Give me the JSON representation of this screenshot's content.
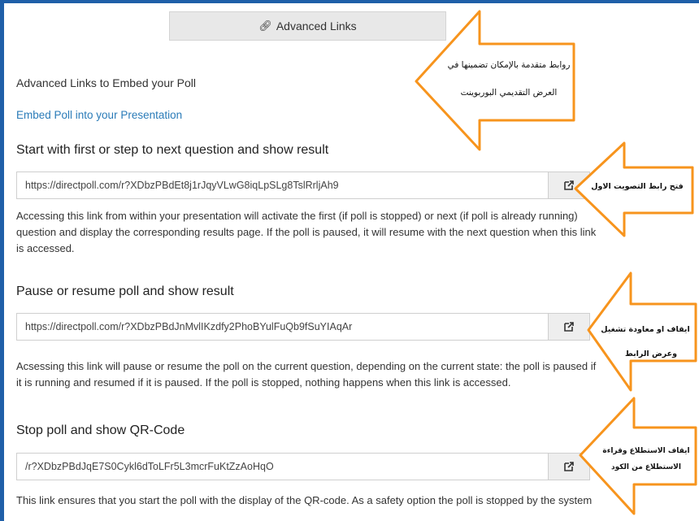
{
  "advanced_tab": {
    "icon": "link-icon",
    "label": "Advanced Links"
  },
  "section": {
    "title": "Advanced Links to Embed your Poll",
    "embed_link": "Embed Poll into your Presentation"
  },
  "links": [
    {
      "heading": "Start with first or step to next question and show result",
      "url": "https://directpoll.com/r?XDbzPBdEt8j1rJqyVLwG8iqLpSLg8TslRrljAh9",
      "description": "Accessing this link from within your presentation will activate the first (if poll is stopped) or next (if poll is already running) question and display the corresponding results page. If the poll is paused, it will resume with the next question when this link is accessed.",
      "open_icon": "external-link-icon"
    },
    {
      "heading": "Pause or resume poll and show result",
      "url": "https://directpoll.com/r?XDbzPBdJnMvlIKzdfy2PhoBYulFuQb9fSuYIAqAr",
      "description": "Acsessing this link will pause or resume the poll on the current question, depending on the current state: the poll is paused if it is running and resumed if it is paused. If the poll is stopped, nothing happens when this link is accessed.",
      "open_icon": "external-link-icon"
    },
    {
      "heading": "Stop poll and show QR-Code",
      "url": "/r?XDbzPBdJqE7S0Cykl6dToLFr5L3mcrFuKtZzAoHqO",
      "description": "This link ensures that you start the poll with the display of the QR-code. As a safety option the poll is stopped by the system too. Pretty useful if you",
      "open_icon": "external-link-icon"
    }
  ],
  "annotations": {
    "top_line1": "روابط متقدمة بالإمكان تضمينها في",
    "top_line2": "العرض التقديمي البوربوينت",
    "first": "فتح رابط التصويت الاول",
    "second_line1": "ايقاف او معاودة تشغيل",
    "second_line2": "وعرض الرابط",
    "third_line1": "ايقاف الاستطلاع وقراءة",
    "third_line2": "الاستطلاع من الكود"
  },
  "colors": {
    "frame": "#1f5fa8",
    "link": "#2a7bb8",
    "arrow_stroke": "#f7941d"
  }
}
